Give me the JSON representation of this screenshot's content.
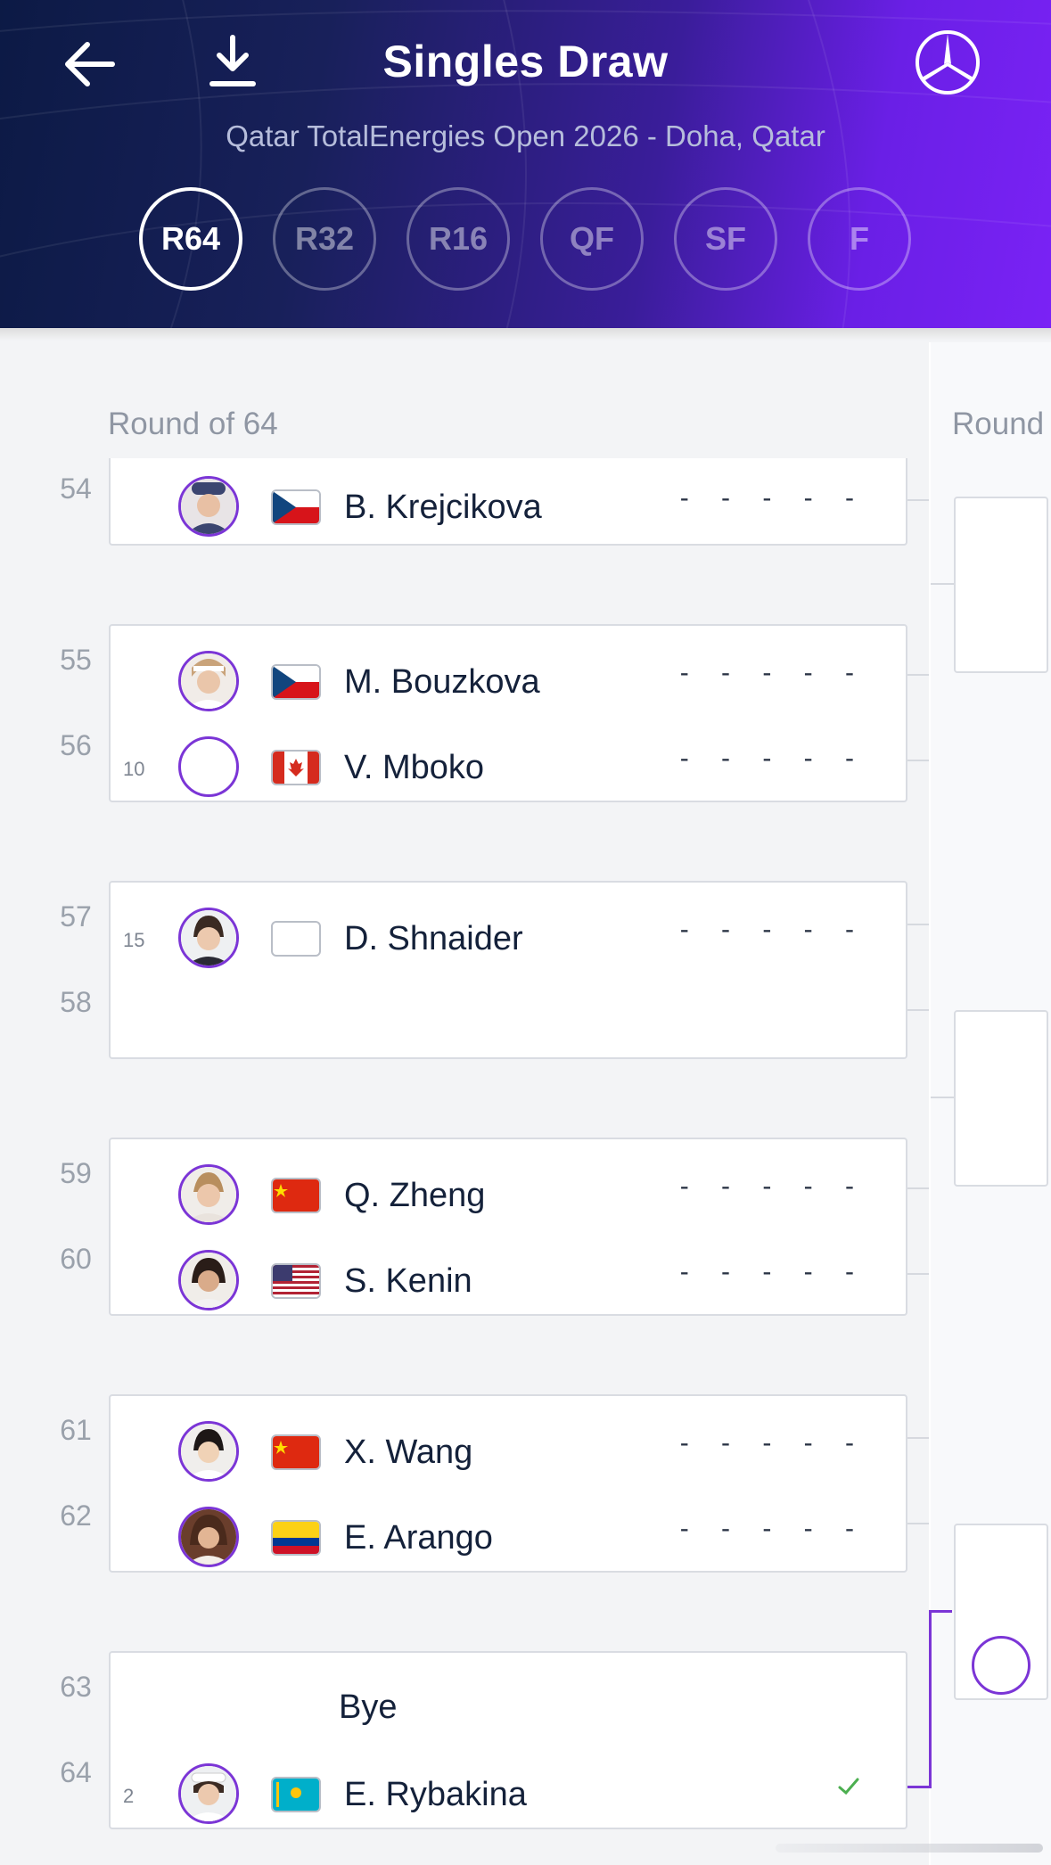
{
  "header": {
    "title": "Singles Draw",
    "subtitle": "Qatar TotalEnergies Open 2026 - Doha, Qatar",
    "icons": {
      "back": "arrow-left-icon",
      "download": "download-icon",
      "sponsor": "mercedes-star-logo"
    },
    "rounds": [
      {
        "label": "R64",
        "active": true
      },
      {
        "label": "R32",
        "active": false
      },
      {
        "label": "R16",
        "active": false
      },
      {
        "label": "QF",
        "active": false
      },
      {
        "label": "SF",
        "active": false
      },
      {
        "label": "F",
        "active": false
      }
    ]
  },
  "draw": {
    "round_label": "Round of 64",
    "next_round_label": "Round",
    "positions": [
      "54",
      "55",
      "56",
      "57",
      "58",
      "59",
      "60",
      "61",
      "62",
      "63",
      "64"
    ],
    "matches": [
      {
        "players": [
          {
            "name": "B. Krejcikova",
            "seed": "",
            "flag": "CZE",
            "score": "- - - - -"
          }
        ]
      },
      {
        "players": [
          {
            "name": "M. Bouzkova",
            "seed": "",
            "flag": "CZE",
            "score": "- - - - -"
          },
          {
            "name": "V. Mboko",
            "seed": "10",
            "flag": "CAN",
            "score": "- - - - -"
          }
        ]
      },
      {
        "players": [
          {
            "name": "D. Shnaider",
            "seed": "15",
            "flag": "NONE",
            "score": "- - - - -"
          }
        ]
      },
      {
        "players": [
          {
            "name": "Q. Zheng",
            "seed": "",
            "flag": "CHN",
            "score": "- - - - -"
          },
          {
            "name": "S. Kenin",
            "seed": "",
            "flag": "USA",
            "score": "- - - - -"
          }
        ]
      },
      {
        "players": [
          {
            "name": "X. Wang",
            "seed": "",
            "flag": "CHN",
            "score": "- - - - -"
          },
          {
            "name": "E. Arango",
            "seed": "",
            "flag": "COL",
            "score": "- - - - -"
          }
        ]
      },
      {
        "players": [
          {
            "name": "Bye"
          },
          {
            "name": "E. Rybakina",
            "seed": "2",
            "flag": "KAZ",
            "winner": true
          }
        ]
      }
    ]
  },
  "colors": {
    "accent": "#7b35d6",
    "win_check": "#4caf50",
    "header_start": "#0c1a45",
    "header_end": "#7a22f5"
  }
}
